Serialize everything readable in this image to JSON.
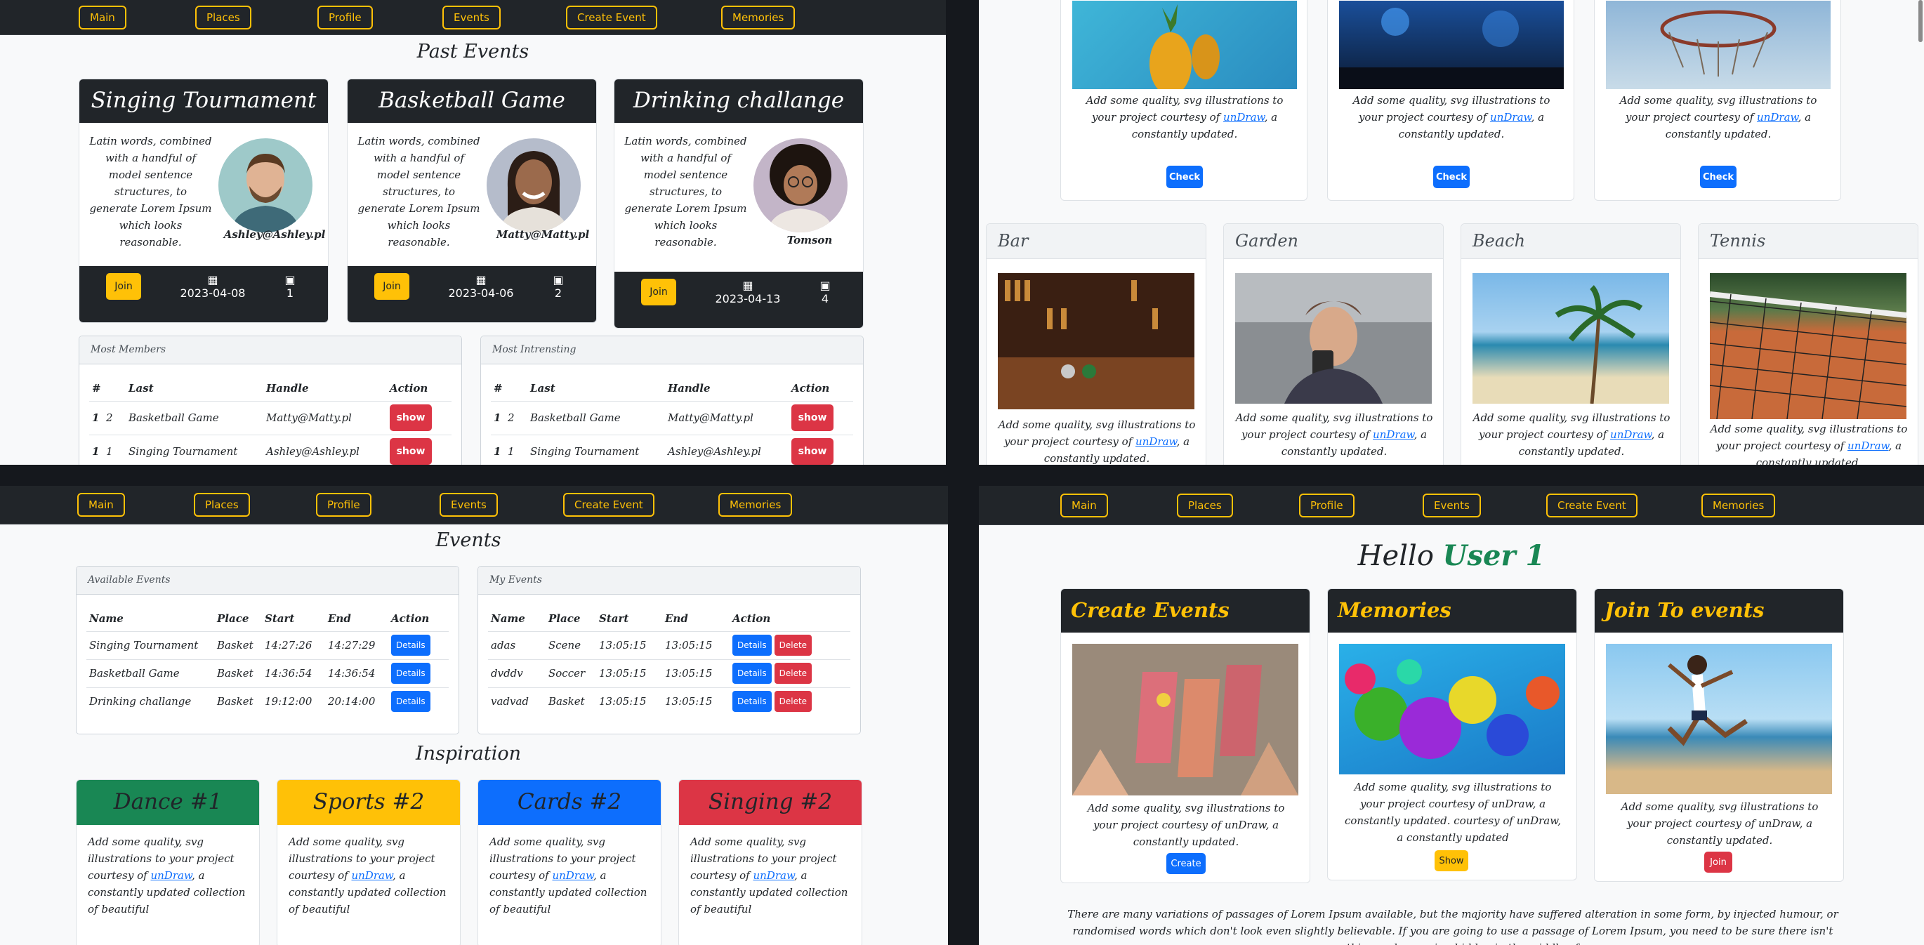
{
  "nav": [
    "Main",
    "Places",
    "Profile",
    "Events",
    "Create Event",
    "Memories"
  ],
  "past_events": {
    "title": "Past Events",
    "cards": [
      {
        "title": "Singing Tournament",
        "text": "Latin words, combined with a handful of model sentence structures, to generate Lorem Ipsum which looks reasonable.",
        "handle": "Ashley@Ashley.pl",
        "join": "Join",
        "date": "2023-04-08",
        "count": "1"
      },
      {
        "title": "Basketball Game",
        "text": "Latin words, combined with a handful of model sentence structures, to generate Lorem Ipsum which looks reasonable.",
        "handle": "Matty@Matty.pl",
        "join": "Join",
        "date": "2023-04-06",
        "count": "2"
      },
      {
        "title": "Drinking challange",
        "text": "Latin words, combined with a handful of model sentence structures, to generate Lorem Ipsum which looks reasonable.",
        "handle": "Tomson",
        "join": "Join",
        "date": "2023-04-13",
        "count": "4"
      }
    ],
    "most_members": {
      "title": "Most Members",
      "headers": [
        "#",
        "Last",
        "Handle",
        "Action"
      ],
      "rows": [
        [
          "1",
          "2",
          "Basketball Game",
          "Matty@Matty.pl",
          "show"
        ],
        [
          "1",
          "1",
          "Singing Tournament",
          "Ashley@Ashley.pl",
          "show"
        ]
      ]
    },
    "most_interesting": {
      "title": "Most Intrensting",
      "headers": [
        "#",
        "Last",
        "Handle",
        "Action"
      ],
      "rows": [
        [
          "1",
          "2",
          "Basketball Game",
          "Matty@Matty.pl",
          "show"
        ],
        [
          "1",
          "1",
          "Singing Tournament",
          "Ashley@Ashley.pl",
          "show"
        ]
      ]
    }
  },
  "places": {
    "text_pre": "Add some quality, svg illustrations to your project courtesy of",
    "link": "unDraw",
    "text_post": ", a constantly updated.",
    "check": "Check",
    "items": [
      "Bar",
      "Garden",
      "Beach",
      "Tennis"
    ]
  },
  "events": {
    "title": "Events",
    "available": {
      "title": "Available Events",
      "headers": [
        "Name",
        "Place",
        "Start",
        "End",
        "Action"
      ],
      "rows": [
        [
          "Singing Tournament",
          "Basket",
          "14:27:26",
          "14:27:29"
        ],
        [
          "Basketball Game",
          "Basket",
          "14:36:54",
          "14:36:54"
        ],
        [
          "Drinking challange",
          "Basket",
          "19:12:00",
          "20:14:00"
        ]
      ],
      "details": "Details"
    },
    "mine": {
      "title": "My Events",
      "headers": [
        "Name",
        "Place",
        "Start",
        "End",
        "Action"
      ],
      "rows": [
        [
          "adas",
          "Scene",
          "13:05:15",
          "13:05:15"
        ],
        [
          "dvddv",
          "Soccer",
          "13:05:15",
          "13:05:15"
        ],
        [
          "vadvad",
          "Basket",
          "13:05:15",
          "13:05:15"
        ]
      ],
      "details": "Details",
      "delete": "Delete"
    },
    "inspiration_title": "Inspiration",
    "inspiration": [
      {
        "title": "Dance #1",
        "color": "#198754",
        "text_color": "#212529"
      },
      {
        "title": "Sports #2",
        "color": "#ffc107",
        "text_color": "#212529"
      },
      {
        "title": "Cards #2",
        "color": "#0d6efd",
        "text_color": "#212529"
      },
      {
        "title": "Singing #2",
        "color": "#dc3545",
        "text_color": "#212529"
      }
    ],
    "insp_text_pre": "Add some quality, svg illustrations to your project courtesy of",
    "insp_link": "unDraw",
    "insp_text_post": ", a constantly updated collection of beautiful"
  },
  "home": {
    "hello": "Hello",
    "user": "User 1",
    "cards": [
      {
        "title": "Create Events",
        "text": "Add some quality, svg illustrations to your project courtesy of unDraw, a constantly updated.",
        "button": "Create",
        "btn_color": "#0d6efd"
      },
      {
        "title": "Memories",
        "text": "Add some quality, svg illustrations to your project courtesy of unDraw, a constantly updated. courtesy of unDraw, a constantly updated",
        "button": "Show",
        "btn_color": "#ffc107"
      },
      {
        "title": "Join To events",
        "text": "Add some quality, svg illustrations to your project courtesy of unDraw, a constantly updated.",
        "button": "Join",
        "btn_color": "#dc3545"
      }
    ],
    "lorem": "There are many variations of passages of Lorem Ipsum available, but the majority have suffered alteration in some form, by injected humour, or randomised words which don't look even slightly believable. If you are going to use a passage of Lorem Ipsum, you need to be sure there isn't anything embarrassing hidden in the middle of"
  },
  "colors": {
    "accent": "#ffc107",
    "dark": "#212529",
    "primary": "#0d6efd",
    "danger": "#dc3545",
    "success": "#198754"
  }
}
